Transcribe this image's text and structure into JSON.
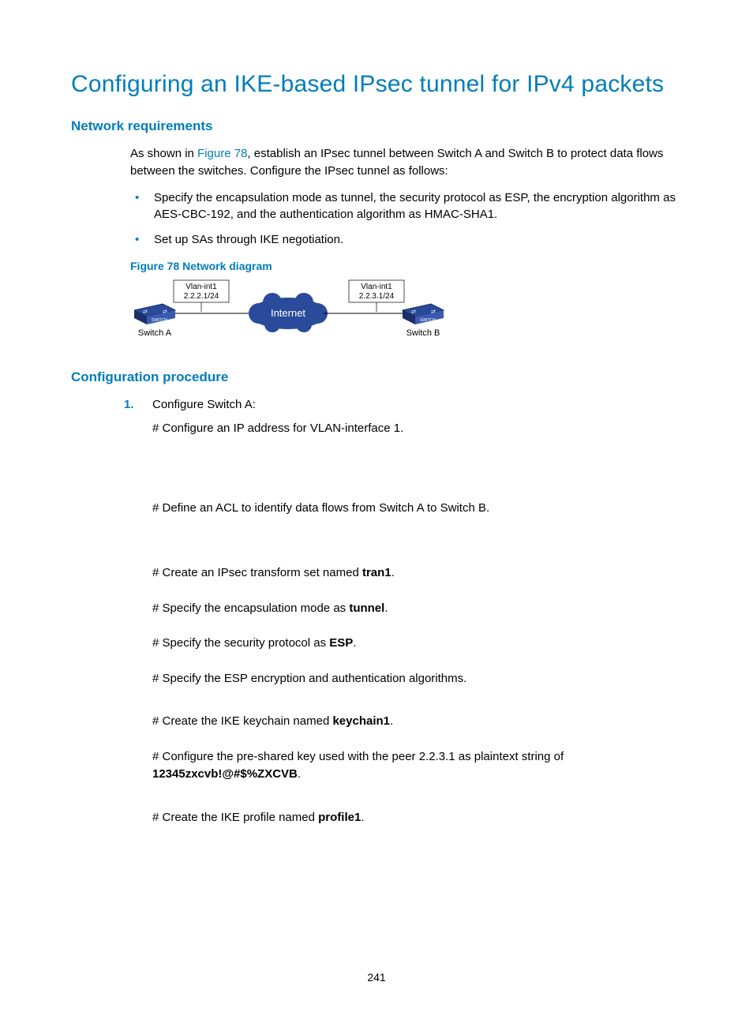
{
  "title": "Configuring an IKE-based IPsec tunnel for IPv4 packets",
  "sections": {
    "net_req": "Network requirements",
    "config_proc": "Configuration procedure"
  },
  "intro": {
    "pre": "As shown in ",
    "link": "Figure 78",
    "post": ", establish an IPsec tunnel between Switch A and Switch B to protect data flows between the switches. Configure the IPsec tunnel as follows:"
  },
  "bullets": [
    "Specify the encapsulation mode as tunnel, the security protocol as ESP, the encryption algorithm as AES-CBC-192, and the authentication algorithm as HMAC-SHA1.",
    "Set up SAs through IKE negotiation."
  ],
  "figure_caption": "Figure 78 Network diagram",
  "diagram": {
    "switchA_label": "Switch A",
    "switchA_int": "Vlan-int1",
    "switchA_ip": "2.2.2.1/24",
    "internet": "Internet",
    "switchB_label": "Switch B",
    "switchB_int": "Vlan-int1",
    "switchB_ip": "2.2.3.1/24"
  },
  "procedure": {
    "step1_title": "Configure Switch A:",
    "s1": "# Configure an IP address for VLAN-interface 1.",
    "s2": "# Define an ACL to identify data flows from Switch A to Switch B.",
    "s3_pre": "# Create an IPsec transform set named ",
    "s3_b": "tran1",
    "s3_post": ".",
    "s4_pre": "# Specify the encapsulation mode as ",
    "s4_b": "tunnel",
    "s4_post": ".",
    "s5_pre": "# Specify the security protocol as ",
    "s5_b": "ESP",
    "s5_post": ".",
    "s6": "# Specify the ESP encryption and authentication algorithms.",
    "s7_pre": "# Create the IKE keychain named ",
    "s7_b": "keychain1",
    "s7_post": ".",
    "s8_pre": "# Configure the pre-shared key used with the peer 2.2.3.1 as plaintext string of ",
    "s8_b": "12345zxcvb!@#$%ZXCVB",
    "s8_post": ".",
    "s9_pre": "# Create the IKE profile named ",
    "s9_b": "profile1",
    "s9_post": "."
  },
  "page_number": "241"
}
